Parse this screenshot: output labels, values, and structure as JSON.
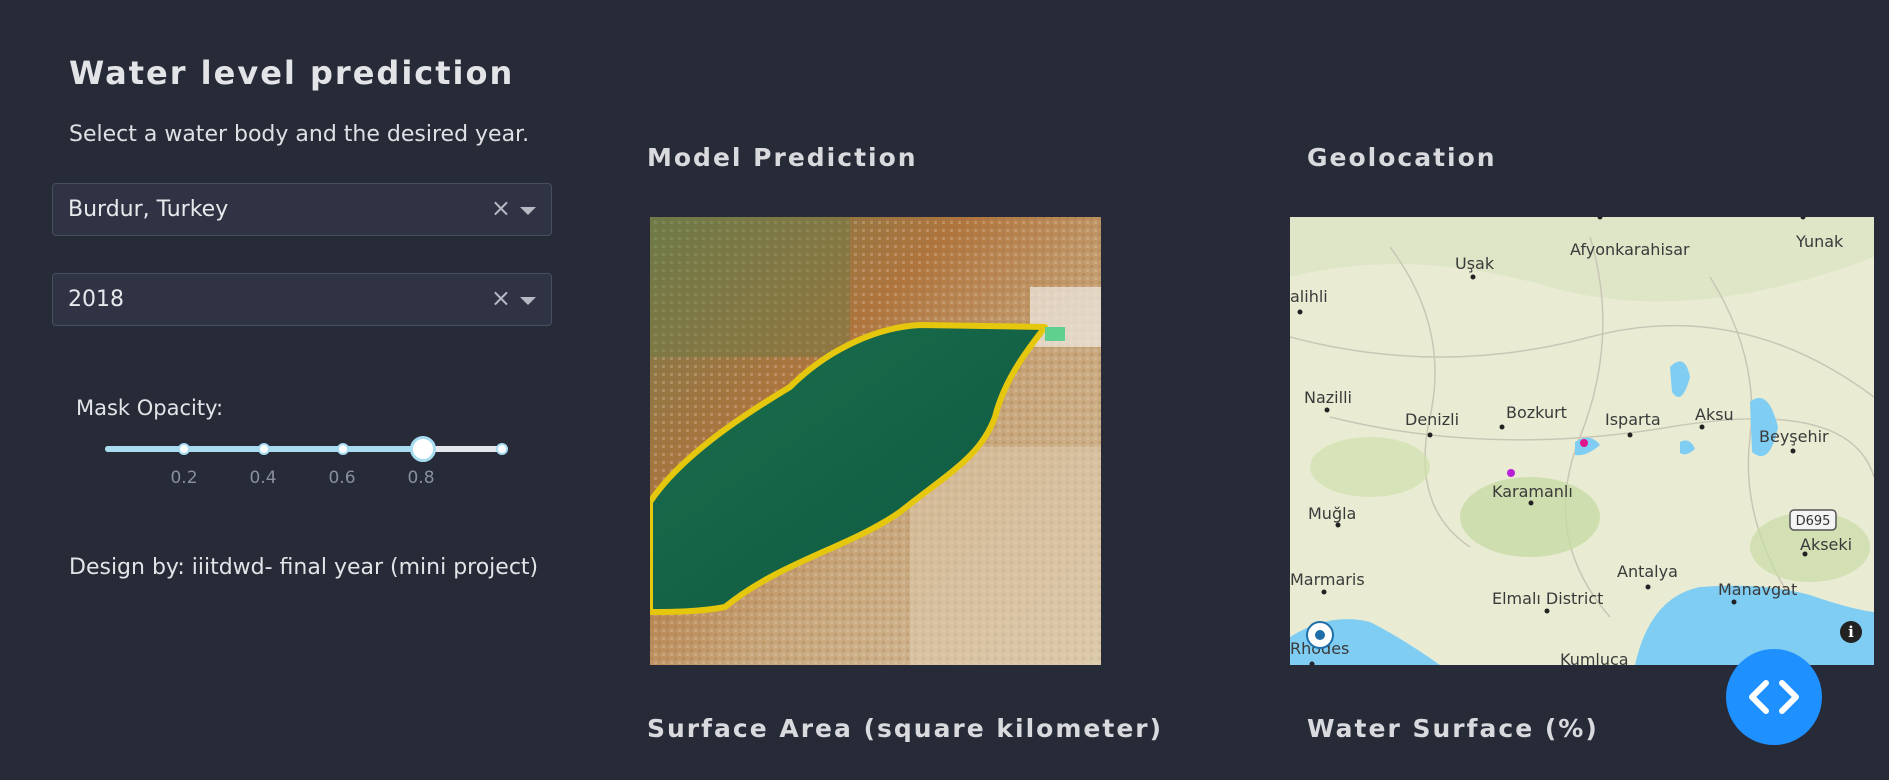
{
  "header": {
    "title": "Water level prediction",
    "subtitle": "Select a water body and the desired year."
  },
  "controls": {
    "water_body": {
      "value": "Burdur, Turkey",
      "clear": "×"
    },
    "year": {
      "value": "2018",
      "clear": "×"
    },
    "opacity": {
      "label": "Mask Opacity:",
      "value": 0.8,
      "min": 0,
      "max": 1,
      "tick_labels": [
        "0.2",
        "0.4",
        "0.6",
        "0.8"
      ]
    }
  },
  "credit": "Design by: iiitdwd- final year (mini project)",
  "sections": {
    "model_prediction": "Model Prediction",
    "geolocation": "Geolocation",
    "surface_area": "Surface Area (square kilometer)",
    "water_surface": "Water Surface (%)"
  },
  "map": {
    "labels": [
      "Uşak",
      "Afyonkarahisar",
      "Yunak",
      "alihli",
      "Nazilli",
      "Denizli",
      "Bozkurt",
      "Isparta",
      "Aksu",
      "Beyşehir",
      "Karamanlı",
      "Muğla",
      "D695",
      "Akseki",
      "Antalya",
      "Manavgat",
      "Marmaris",
      "Elmalı District",
      "Rhodes",
      "Kumluca"
    ],
    "info_icon": "i"
  },
  "colors": {
    "background": "#272b38",
    "accent": "#1e90ff",
    "slider": "#a8dcf1",
    "mask_outline": "#e5c70d"
  },
  "icons": [
    "clear-icon",
    "caret-down-icon",
    "code-icon",
    "info-icon",
    "compass-icon"
  ]
}
